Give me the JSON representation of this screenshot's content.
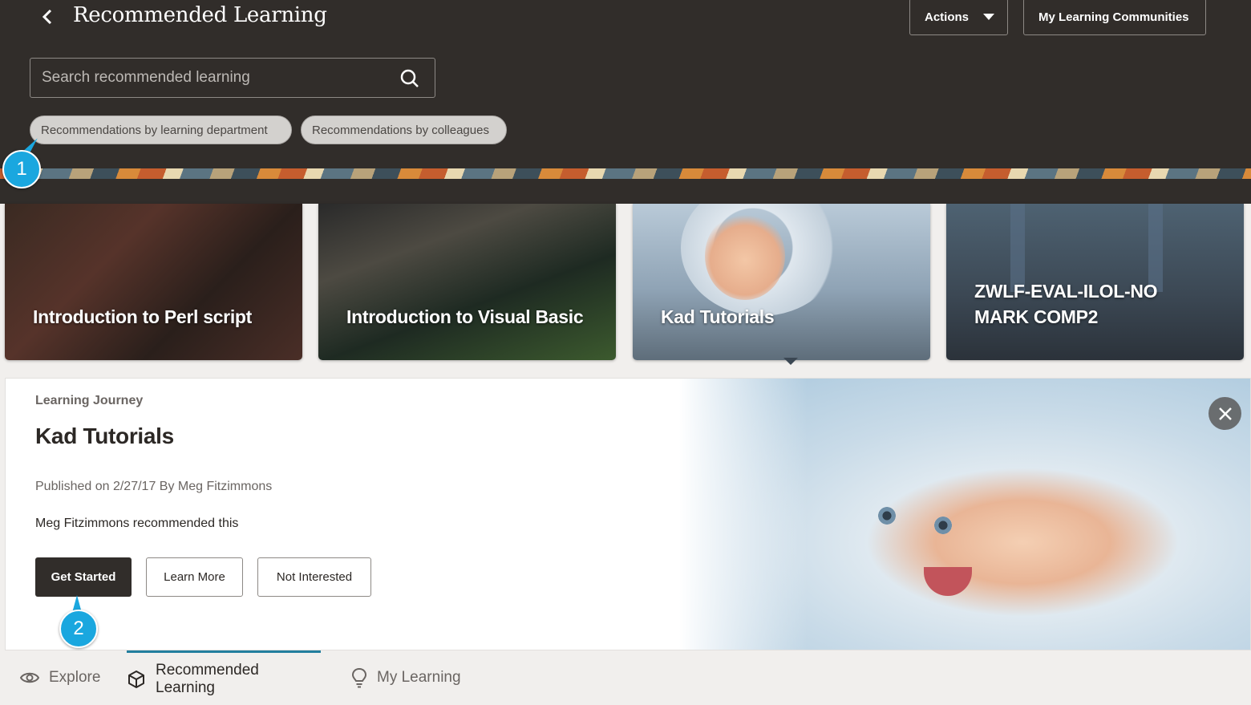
{
  "header": {
    "back_icon": "chevron-left-icon",
    "title": "Recommended Learning",
    "actions_label": "Actions",
    "communities_label": "My Learning Communities",
    "search_placeholder": "Search recommended learning",
    "chips": [
      "Recommendations by learning department",
      "Recommendations by colleagues"
    ]
  },
  "markers": [
    "1",
    "2"
  ],
  "cards": [
    {
      "title": "Introduction to Perl script"
    },
    {
      "title": "Introduction to Visual Basic"
    },
    {
      "title": "Kad Tutorials"
    },
    {
      "title": "ZWLF-EVAL-ILOL-NO MARK COMP2"
    }
  ],
  "detail": {
    "kicker": "Learning Journey",
    "title": "Kad Tutorials",
    "published": "Published on 2/27/17 By Meg Fitzimmons",
    "recommended": "Meg Fitzimmons recommended this",
    "get_started": "Get Started",
    "learn_more": "Learn More",
    "not_interested": "Not Interested"
  },
  "bottom_nav": [
    {
      "label": "Explore",
      "icon": "eye-icon"
    },
    {
      "label": "Recommended Learning",
      "icon": "cube-icon",
      "active": true
    },
    {
      "label": "My Learning",
      "icon": "lightbulb-icon"
    }
  ],
  "colors": {
    "header_bg": "#312d2a",
    "marker": "#1aa7df",
    "active_tab": "#227e9e"
  }
}
